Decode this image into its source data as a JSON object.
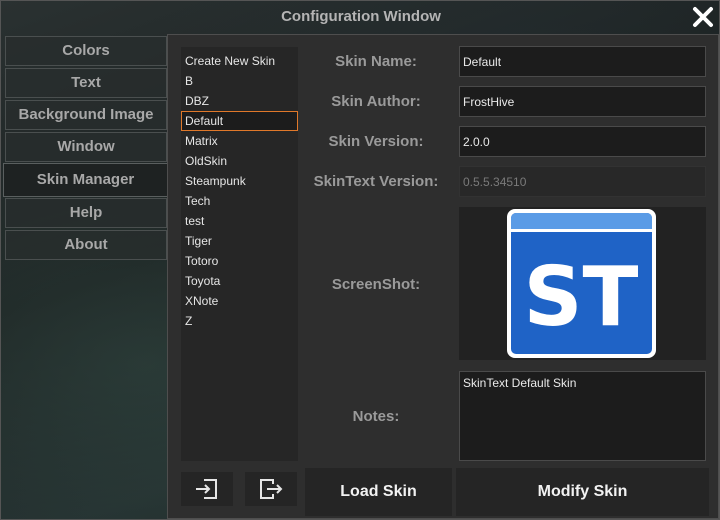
{
  "window": {
    "title": "Configuration Window"
  },
  "nav": {
    "items": [
      {
        "label": "Colors"
      },
      {
        "label": "Text"
      },
      {
        "label": "Background Image"
      },
      {
        "label": "Window"
      },
      {
        "label": "Skin Manager",
        "active": true
      },
      {
        "label": "Help"
      },
      {
        "label": "About"
      }
    ]
  },
  "skins": {
    "items": [
      "Create New Skin",
      "B",
      "DBZ",
      "Default",
      "Matrix",
      "OldSkin",
      "Steampunk",
      "Tech",
      "test",
      "Tiger",
      "Totoro",
      "Toyota",
      "XNote",
      "Z"
    ],
    "selected": "Default"
  },
  "form": {
    "skin_name_label": "Skin Name:",
    "skin_name_value": "Default",
    "skin_author_label": "Skin Author:",
    "skin_author_value": "FrostHive",
    "skin_version_label": "Skin Version:",
    "skin_version_value": "2.0.0",
    "skintext_version_label": "SkinText Version:",
    "skintext_version_value": "0.5.5.34510",
    "screenshot_label": "ScreenShot:",
    "screenshot_logo_text": "ST",
    "notes_label": "Notes:",
    "notes_value": "SkinText Default Skin"
  },
  "buttons": {
    "import_icon": "import-icon",
    "export_icon": "export-icon",
    "load_skin": "Load Skin",
    "modify_skin": "Modify Skin"
  },
  "colors": {
    "selection_border": "#e0782a",
    "logo_blue": "#1f63c6"
  }
}
